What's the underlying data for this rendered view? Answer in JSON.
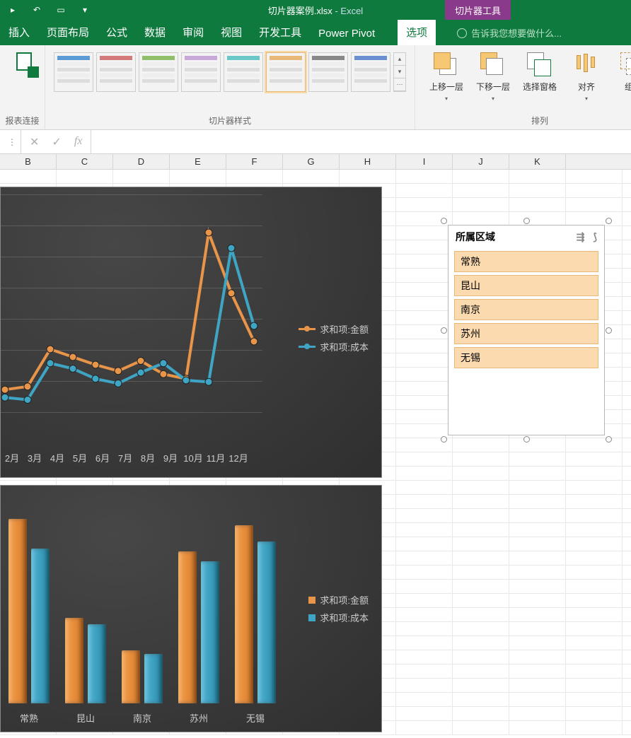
{
  "titlebar": {
    "filename": "切片器案例.xlsx",
    "app": "Excel",
    "slicer_tools": "切片器工具"
  },
  "tabs": {
    "insert": "插入",
    "layout": "页面布局",
    "formula": "公式",
    "data": "数据",
    "review": "审阅",
    "view": "视图",
    "dev": "开发工具",
    "powerpivot": "Power Pivot",
    "options": "选项",
    "tellme": "告诉我您想要做什么..."
  },
  "ribbon": {
    "report_connections": "报表连接",
    "styles_label": "切片器样式",
    "bring_forward": "上移一层",
    "send_backward": "下移一层",
    "selection_pane": "选择窗格",
    "align": "对齐",
    "group": "组合",
    "arrange_label": "排列"
  },
  "formula_bar": {
    "fx": "fx"
  },
  "columns": [
    "B",
    "C",
    "D",
    "E",
    "F",
    "G",
    "H",
    "I",
    "J",
    "K"
  ],
  "chart_data": [
    {
      "type": "line",
      "title": "",
      "categories": [
        "2月",
        "3月",
        "4月",
        "5月",
        "6月",
        "7月",
        "8月",
        "9月",
        "10月",
        "11月",
        "12月"
      ],
      "series": [
        {
          "name": "求和项:金额",
          "color": "#e8954a",
          "values": [
            58,
            62,
            110,
            100,
            90,
            82,
            95,
            78,
            72,
            260,
            182,
            120
          ]
        },
        {
          "name": "求和项:成本",
          "color": "#3fa5c4",
          "values": [
            48,
            45,
            92,
            85,
            72,
            66,
            80,
            92,
            70,
            68,
            240,
            140
          ]
        }
      ],
      "ylim": [
        0,
        300
      ]
    },
    {
      "type": "bar",
      "title": "",
      "categories": [
        "常熟",
        "昆山",
        "南京",
        "苏州",
        "无锡"
      ],
      "series": [
        {
          "name": "求和项:金额",
          "color": "#e8954a",
          "values": [
            280,
            130,
            80,
            230,
            270
          ]
        },
        {
          "name": "求和项:成本",
          "color": "#3fa5c4",
          "values": [
            235,
            120,
            75,
            215,
            245
          ]
        }
      ],
      "ylim": [
        0,
        300
      ]
    }
  ],
  "slicer": {
    "title": "所属区域",
    "items": [
      "常熟",
      "昆山",
      "南京",
      "苏州",
      "无锡"
    ]
  },
  "style_colors": [
    "#5a9bd5",
    "#d57a7a",
    "#8fbf6a",
    "#c8a8d8",
    "#6ac8c8",
    "#e8b878",
    "#888888",
    "#6a8fd0"
  ]
}
